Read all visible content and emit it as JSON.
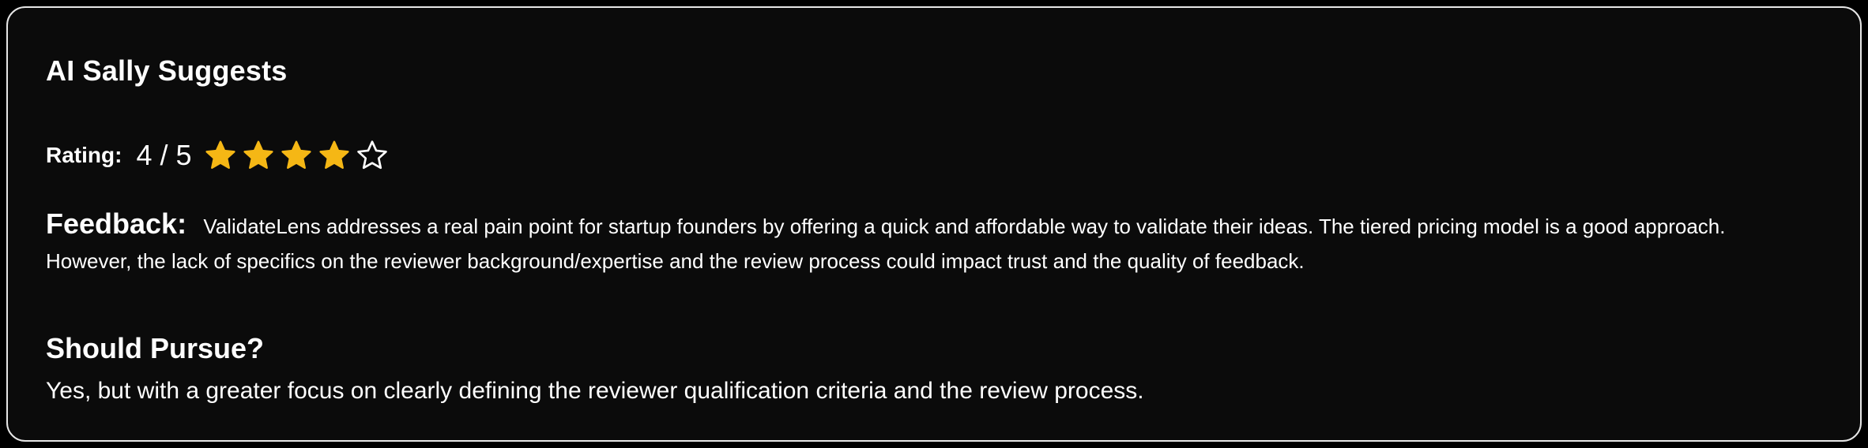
{
  "card": {
    "title": "AI Sally Suggests",
    "rating": {
      "label": "Rating:",
      "value_text": "4 / 5",
      "score": 4,
      "max": 5,
      "filled_color": "#F5B715",
      "empty_color": "#ffffff",
      "icon": "star-icon"
    },
    "feedback": {
      "label": "Feedback:",
      "text": "ValidateLens addresses a real pain point for startup founders by offering a quick and affordable way to validate their ideas. The tiered pricing model is a good approach. However, the lack of specifics on the reviewer background/expertise and the review process could impact trust and the quality of feedback."
    },
    "pursue": {
      "heading": "Should Pursue?",
      "text": "Yes, but with a greater focus on clearly defining the reviewer qualification criteria and the review process."
    }
  },
  "colors": {
    "background": "#000000",
    "card_background": "#0b0b0b",
    "card_border": "#e6e6e6",
    "text": "#ffffff"
  }
}
